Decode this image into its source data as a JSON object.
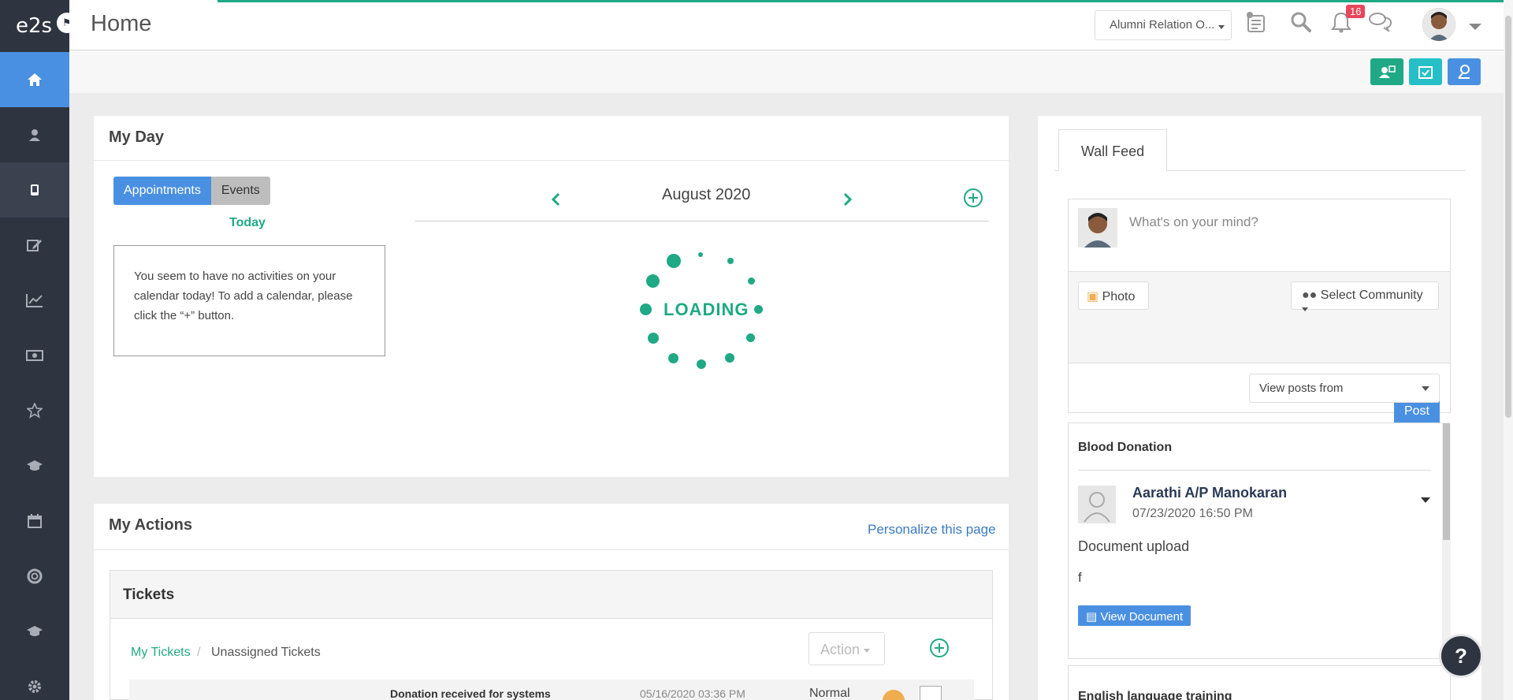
{
  "app": {
    "logo": "e2s"
  },
  "header": {
    "title": "Home",
    "org_select": "Alumni Relation O...",
    "notification_count": "16"
  },
  "sidebar": {
    "items": [
      {
        "icon": "home-icon",
        "active": true
      },
      {
        "icon": "user-icon"
      },
      {
        "icon": "mobile-icon",
        "selected": true
      },
      {
        "icon": "edit-icon"
      },
      {
        "icon": "chart-icon"
      },
      {
        "icon": "money-icon"
      },
      {
        "icon": "star-icon"
      },
      {
        "icon": "graduation-cap-icon"
      },
      {
        "icon": "calendar-icon"
      },
      {
        "icon": "lifebuoy-icon"
      },
      {
        "icon": "graduation-cap-icon"
      },
      {
        "icon": "settings-icon"
      }
    ]
  },
  "quick_actions": {
    "colors": [
      "#1fa985",
      "#26bfc8",
      "#4a90e2"
    ]
  },
  "my_day": {
    "title": "My Day",
    "tabs": [
      "Appointments",
      "Events"
    ],
    "today_label": "Today",
    "empty_message": "You seem to have no activities on your calendar today! To add a calendar, please click the “+” button.",
    "month": "August 2020",
    "loading_text": "LOADING"
  },
  "my_actions": {
    "title": "My Actions",
    "personalize_link": "Personalize this page",
    "tickets": {
      "title": "Tickets",
      "crumb_active": "My Tickets",
      "crumb_sep": "/",
      "crumb_other": "Unassigned Tickets",
      "action_button": "Action",
      "row": {
        "subject": "Donation received for systems",
        "date": "05/16/2020 03:36 PM",
        "priority": "Normal"
      }
    }
  },
  "wall": {
    "tab": "Wall Feed",
    "placeholder": "What's on your mind?",
    "photo_button": "Photo",
    "community_select": "Select Community",
    "post_button": "Post",
    "view_posts_from": "View posts from",
    "posts": [
      {
        "group": "Blood Donation",
        "author": "Aarathi A/P Manokaran",
        "time": "07/23/2020 16:50 PM",
        "body": "Document upload",
        "extra": "f",
        "button": "View Document"
      },
      {
        "group": "English language training"
      }
    ]
  },
  "help_label": "?"
}
